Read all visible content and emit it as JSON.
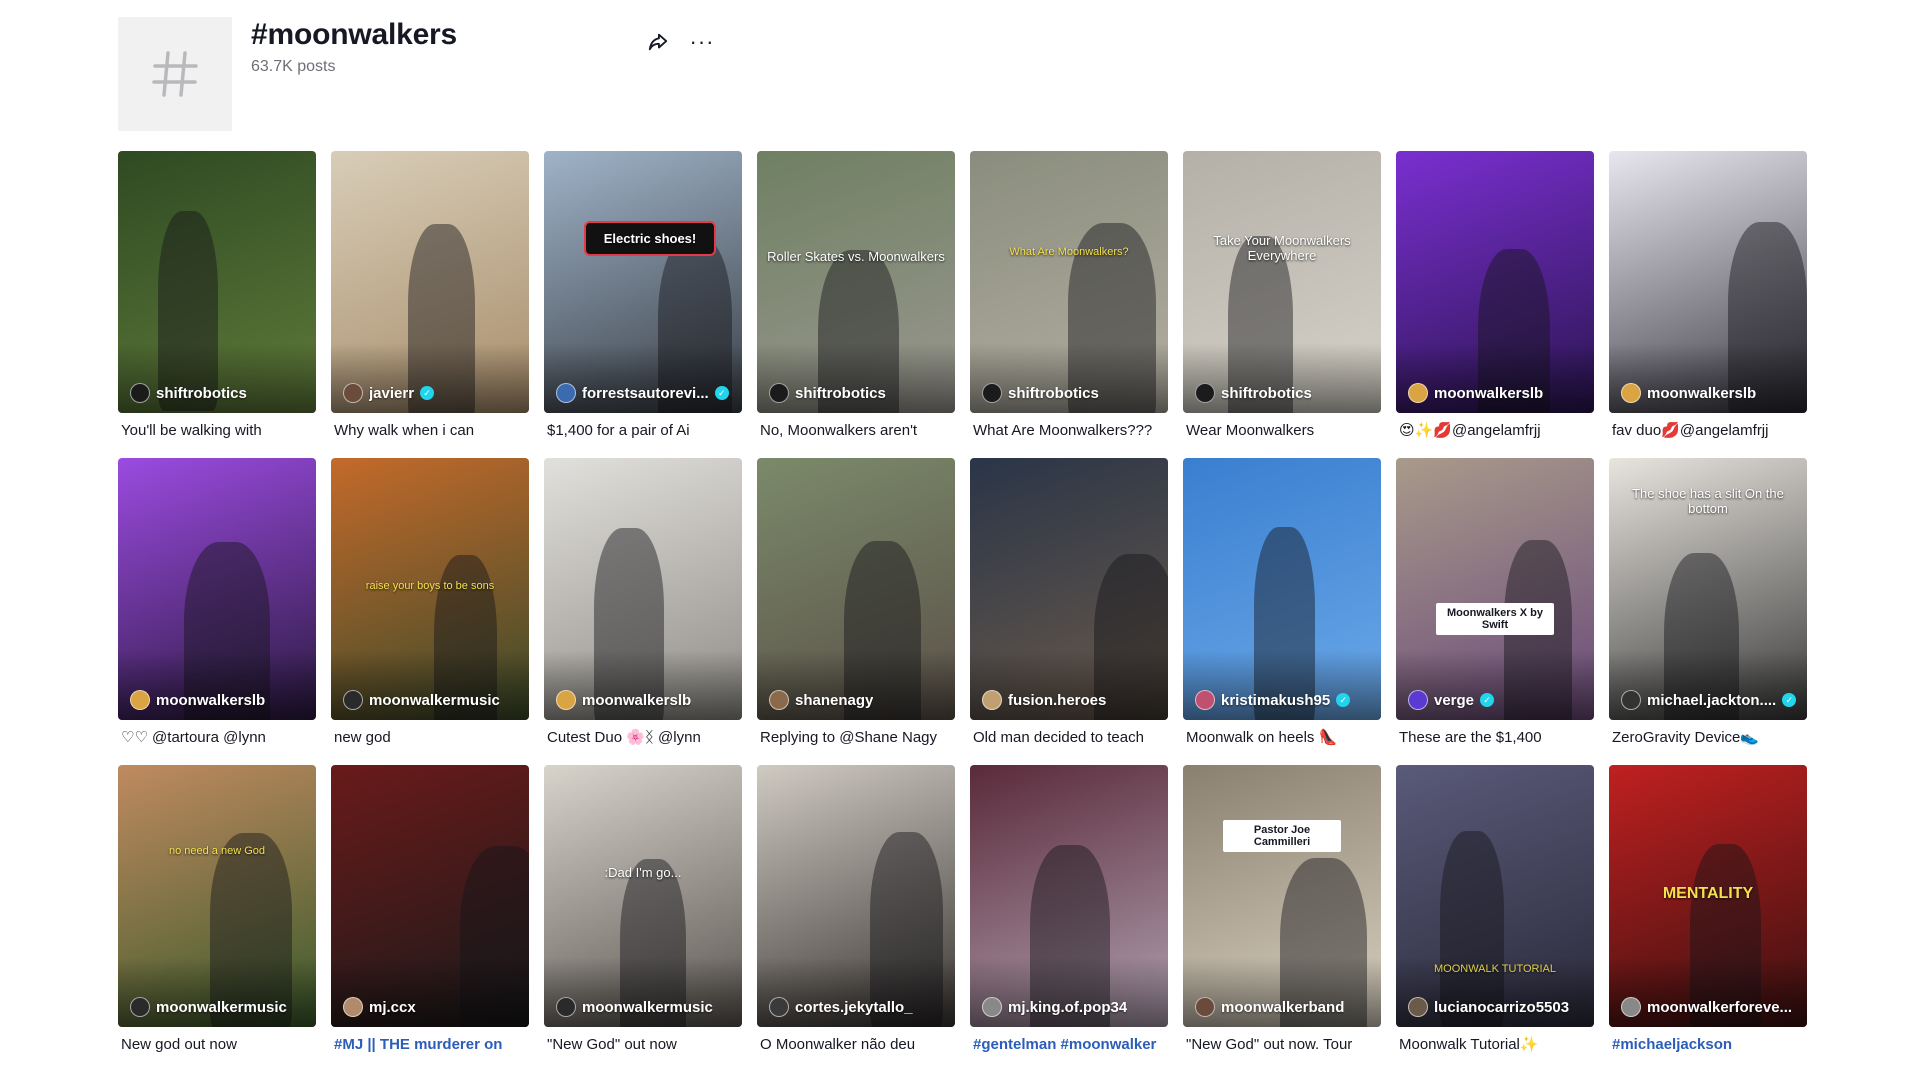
{
  "header": {
    "title": "#moonwalkers",
    "posts_count": "63.7K posts",
    "tag_icon": "hashtag-icon",
    "share_icon": "share-arrow-icon",
    "more_icon": "more-dots-icon",
    "more_label": "···"
  },
  "videos": [
    {
      "author": "shiftrobotics",
      "verified": false,
      "caption": "You'll be walking with",
      "overlay": "",
      "bg": [
        "#2f4a22",
        "#5f7a3a"
      ],
      "avatar": "#1b1b1b"
    },
    {
      "author": "javierr",
      "verified": true,
      "caption": "Why walk when i can",
      "overlay": "",
      "bg": [
        "#d8cdb8",
        "#a88d6a"
      ],
      "avatar": "#6b4b3a"
    },
    {
      "author": "forrestsautorevi...",
      "verified": true,
      "caption": "$1,400 for a pair of Ai",
      "overlay": "Electric shoes!",
      "bg": [
        "#9fb3c8",
        "#3a3f46"
      ],
      "avatar": "#3a6ab0"
    },
    {
      "author": "shiftrobotics",
      "verified": false,
      "caption": "No, Moonwalkers aren't",
      "overlay": "Roller Skates vs. Moonwalkers",
      "bg": [
        "#6f8062",
        "#9a9790"
      ],
      "avatar": "#1b1b1b"
    },
    {
      "author": "shiftrobotics",
      "verified": false,
      "caption": "What Are Moonwalkers???",
      "overlay": "What Are Moonwalkers?",
      "bg": [
        "#8a8d7d",
        "#b3aea2"
      ],
      "avatar": "#1b1b1b"
    },
    {
      "author": "shiftrobotics",
      "verified": false,
      "caption": "Wear Moonwalkers",
      "overlay": "Take Your Moonwalkers Everywhere",
      "bg": [
        "#b4b0a8",
        "#d6d2c8"
      ],
      "avatar": "#1b1b1b"
    },
    {
      "author": "moonwalkerslb",
      "verified": false,
      "caption": "😍✨💋@angelamfrjj",
      "overlay": "",
      "bg": [
        "#7a2fd0",
        "#2a1550"
      ],
      "avatar": "#d9a441"
    },
    {
      "author": "moonwalkerslb",
      "verified": false,
      "caption": "fav duo💋@angelamfrjj",
      "overlay": "",
      "bg": [
        "#e8e6ee",
        "#3c3a44"
      ],
      "avatar": "#d9a441"
    },
    {
      "author": "moonwalkerslb",
      "verified": false,
      "caption": "♡♡ @tartoura @lynn",
      "overlay": "",
      "bg": [
        "#9b4be0",
        "#2b1a40"
      ],
      "avatar": "#d9a441"
    },
    {
      "author": "moonwalkermusic",
      "verified": false,
      "caption": "new god",
      "overlay": "raise your boys to be sons",
      "bg": [
        "#c46a2a",
        "#3a4a2a"
      ],
      "avatar": "#2a2a2a"
    },
    {
      "author": "moonwalkerslb",
      "verified": false,
      "caption": "Cutest Duo 🌸ᛝ @lynn",
      "overlay": "",
      "bg": [
        "#e2e0dc",
        "#8f8c86"
      ],
      "avatar": "#d9a441"
    },
    {
      "author": "shanenagy",
      "verified": false,
      "caption": "Replying to @Shane Nagy",
      "overlay": "",
      "bg": [
        "#7b8a6a",
        "#5a5048"
      ],
      "avatar": "#8a6a4a"
    },
    {
      "author": "fusion.heroes",
      "verified": false,
      "caption": "Old man decided to teach",
      "overlay": "",
      "bg": [
        "#2a3548",
        "#6a5a4a"
      ],
      "avatar": "#c0a070"
    },
    {
      "author": "kristimakush95",
      "verified": true,
      "caption": "Moonwalk on heels 👠",
      "overlay": "",
      "bg": [
        "#3a7fd0",
        "#6aa8e8"
      ],
      "avatar": "#c05070"
    },
    {
      "author": "verge",
      "verified": true,
      "caption": "These are the $1,400",
      "overlay": "Moonwalkers X by Swift",
      "bg": [
        "#a89a8a",
        "#6a4a7a"
      ],
      "avatar": "#5a3ad0"
    },
    {
      "author": "michael.jackton....",
      "verified": true,
      "caption": "ZeroGravity Device👟",
      "overlay": "The shoe has a slit On the bottom",
      "bg": [
        "#e8e4de",
        "#3a3a3a"
      ],
      "avatar": "#333333"
    },
    {
      "author": "moonwalkermusic",
      "verified": false,
      "caption": "New god out now",
      "overlay": "no need a new God",
      "bg": [
        "#c08a60",
        "#3a5a2a"
      ],
      "avatar": "#2a2a2a"
    },
    {
      "author": "mj.ccx",
      "verified": false,
      "caption": "#MJ || THE murderer on",
      "overlay": "",
      "bg": [
        "#6a1a1a",
        "#1a1a1a"
      ],
      "avatar": "#b08a6a"
    },
    {
      "author": "moonwalkermusic",
      "verified": false,
      "caption": "\"New God\" out now",
      "overlay": ":Dad I'm go...",
      "bg": [
        "#d8d4cc",
        "#5a5550"
      ],
      "avatar": "#2a2a2a"
    },
    {
      "author": "cortes.jekytallo_",
      "verified": false,
      "caption": "O Moonwalker não deu",
      "overlay": "",
      "bg": [
        "#cfcac2",
        "#3a3532"
      ],
      "avatar": "#3a3a3a"
    },
    {
      "author": "mj.king.of.pop34",
      "verified": false,
      "caption": "#gentelman #moonwalker",
      "overlay": "",
      "bg": [
        "#5a2a3a",
        "#b0a0b0"
      ],
      "avatar": "#888888"
    },
    {
      "author": "moonwalkerband",
      "verified": false,
      "caption": "\"New God\" out now. Tour",
      "overlay": "Pastor Joe Cammilleri",
      "bg": [
        "#8a8070",
        "#d8d0c0"
      ],
      "avatar": "#6a4a3a"
    },
    {
      "author": "lucianocarrizo5503",
      "verified": false,
      "caption": "Moonwalk Tutorial✨",
      "overlay": "MOONWALK TUTORIAL",
      "bg": [
        "#5a5a7a",
        "#2a2a3a"
      ],
      "avatar": "#6a5a4a"
    },
    {
      "author": "moonwalkerforeve...",
      "verified": false,
      "caption": "#michaeljackson",
      "overlay": "MENTALITY",
      "bg": [
        "#c02020",
        "#3a1010"
      ],
      "avatar": "#888888"
    }
  ]
}
